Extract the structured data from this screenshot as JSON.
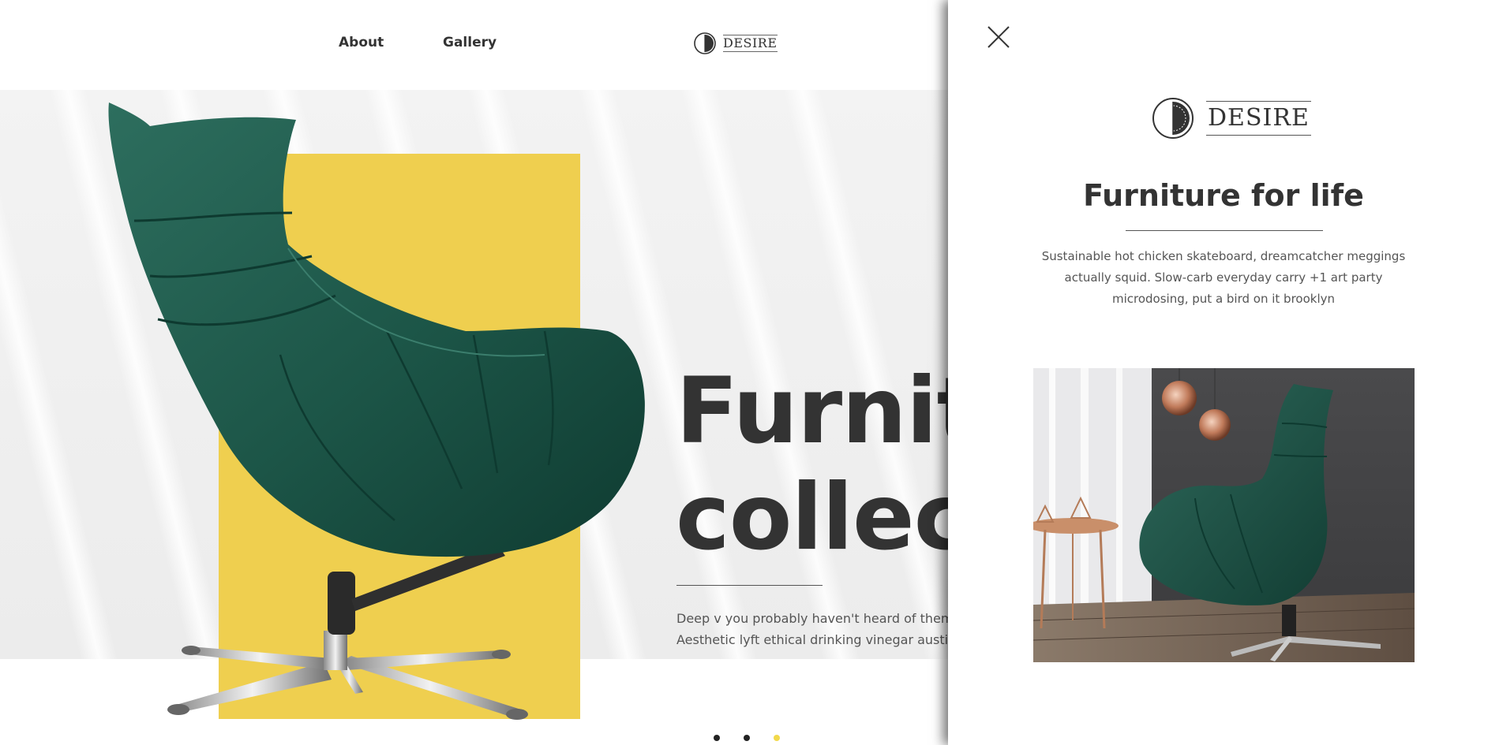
{
  "nav": {
    "about": "About",
    "gallery": "Gallery"
  },
  "brand": {
    "name": "DESIRE"
  },
  "hero": {
    "title": "Furniture\ncollection",
    "text": "Deep v you probably haven't heard of them banh mi. Aesthetic lyft ethical drinking vinegar austint"
  },
  "slider": {
    "dots": 3,
    "active_index": 2
  },
  "panel": {
    "title": "Furniture for life",
    "text": "Sustainable hot chicken skateboard, dreamcatcher meggings actually squid. Slow-carb everyday carry +1 art party microdosing, put a bird on it brooklyn"
  },
  "icons": {
    "close": "close-icon",
    "logo": "desire-logo-mark"
  },
  "colors": {
    "accent_yellow": "#efcf4f",
    "chair_green": "#1f5a4c",
    "text_dark": "#333333",
    "active_dot": "#f2d94b"
  }
}
